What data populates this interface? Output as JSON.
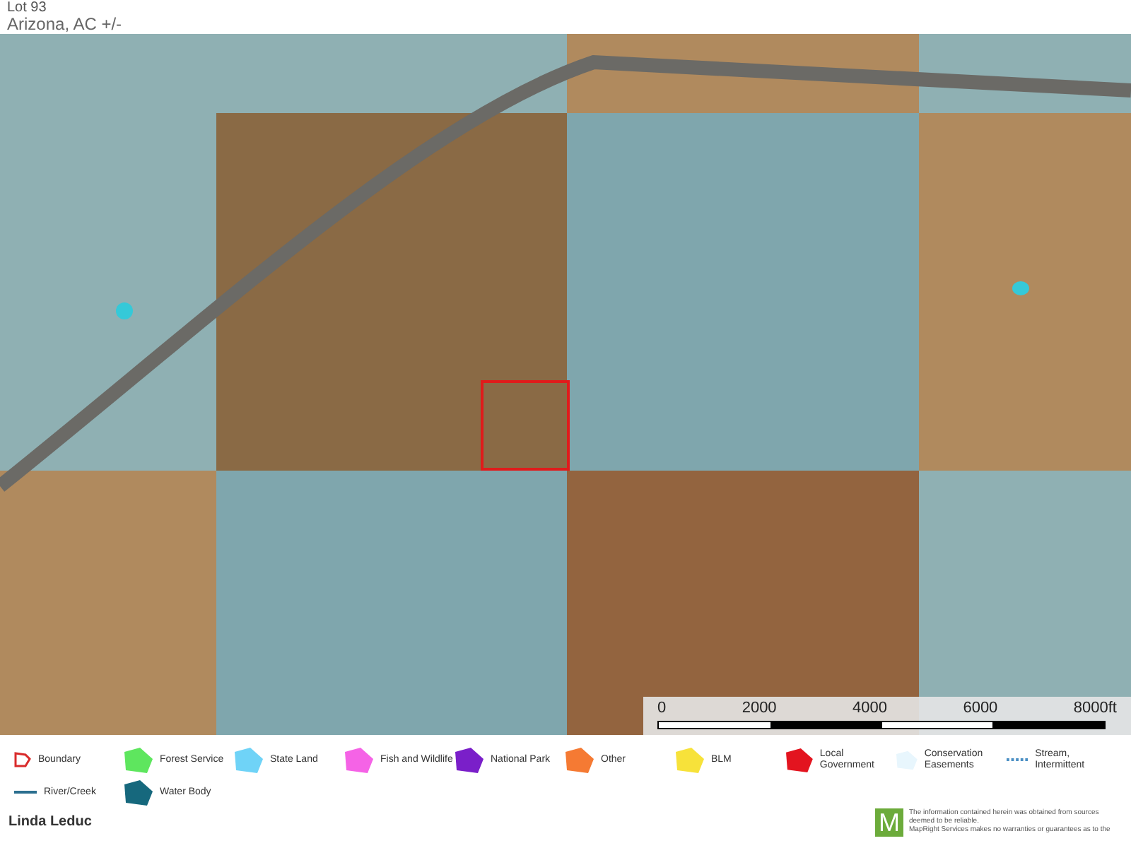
{
  "header": {
    "title": "Lot 93",
    "subtitle": "Arizona,  AC +/-"
  },
  "map": {
    "scale_labels": [
      "0",
      "2000",
      "4000",
      "6000",
      "8000ft"
    ]
  },
  "legend": [
    {
      "label": "Boundary",
      "kind": "outline",
      "color": "#d92b2b"
    },
    {
      "label": "Forest Service",
      "kind": "polygon",
      "color": "#5ee65e"
    },
    {
      "label": "State Land",
      "kind": "polygon",
      "color": "#6fd3f7"
    },
    {
      "label": "Fish and Wildlife",
      "kind": "polygon",
      "color": "#f563e6"
    },
    {
      "label": "National Park",
      "kind": "polygon",
      "color": "#7a1fc9"
    },
    {
      "label": "Other",
      "kind": "polygon",
      "color": "#f57a33"
    },
    {
      "label": "BLM",
      "kind": "polygon",
      "color": "#f7e23a"
    },
    {
      "label": "Local Government",
      "kind": "polygon",
      "color": "#e3141f"
    },
    {
      "label": "Conservation Easements",
      "kind": "polygon",
      "color": "#e8f6fd"
    },
    {
      "label": "Stream, Intermittent",
      "kind": "dashed",
      "color": "#4a8fc4"
    },
    {
      "label": "River/Creek",
      "kind": "line",
      "color": "#2b6f8f"
    },
    {
      "label": "Water Body",
      "kind": "polygon",
      "color": "#16687d"
    }
  ],
  "footer": {
    "agent": "Linda Leduc",
    "logo_letter": "M",
    "disclaimer": [
      "The information contained herein was obtained from sources deemed to be reliable.",
      "MapRight Services makes no warranties or guarantees as to the"
    ]
  }
}
